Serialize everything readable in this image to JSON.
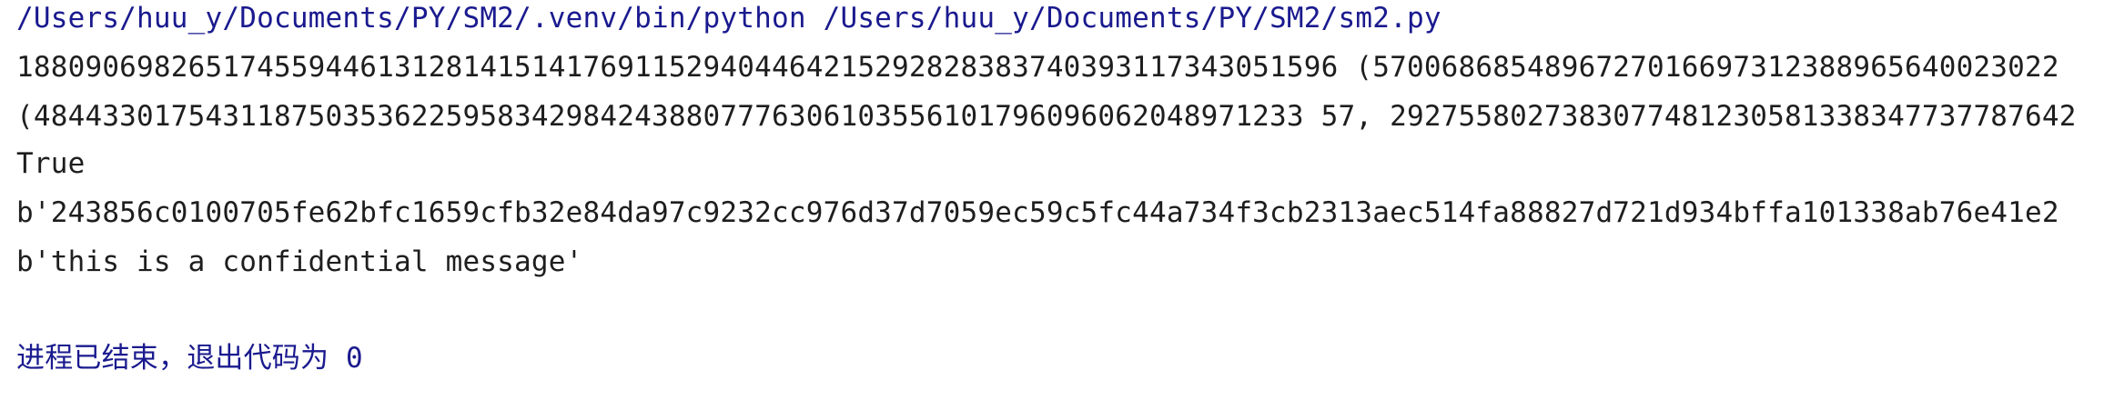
{
  "console": {
    "command": "/Users/huu_y/Documents/PY/SM2/.venv/bin/python /Users/huu_y/Documents/PY/SM2/sm2.py",
    "output_line_1": "18809069826517455944613128141514176911529404464215292828383740393117343051596 (5700686854896727016697312388965640023022",
    "output_line_2": "(48443301754311875035362259583429842438807776306103556101796096062048971233 57, 2927558027383077481230581338347737787642",
    "output_line_3": "True",
    "output_line_4": "b'243856c0100705fe62bfc1659cfb32e84da97c9232cc976d37d7059ec59c5fc44a734f3cb2313aec514fa88827d721d934bffa101338ab76e41e2",
    "output_line_5": "b'this is a confidential message'",
    "exit_message": "进程已结束，退出代码为 0"
  },
  "colors": {
    "background": "#ffffff",
    "text": "#1e1e1e",
    "command": "#1a1a8f"
  }
}
